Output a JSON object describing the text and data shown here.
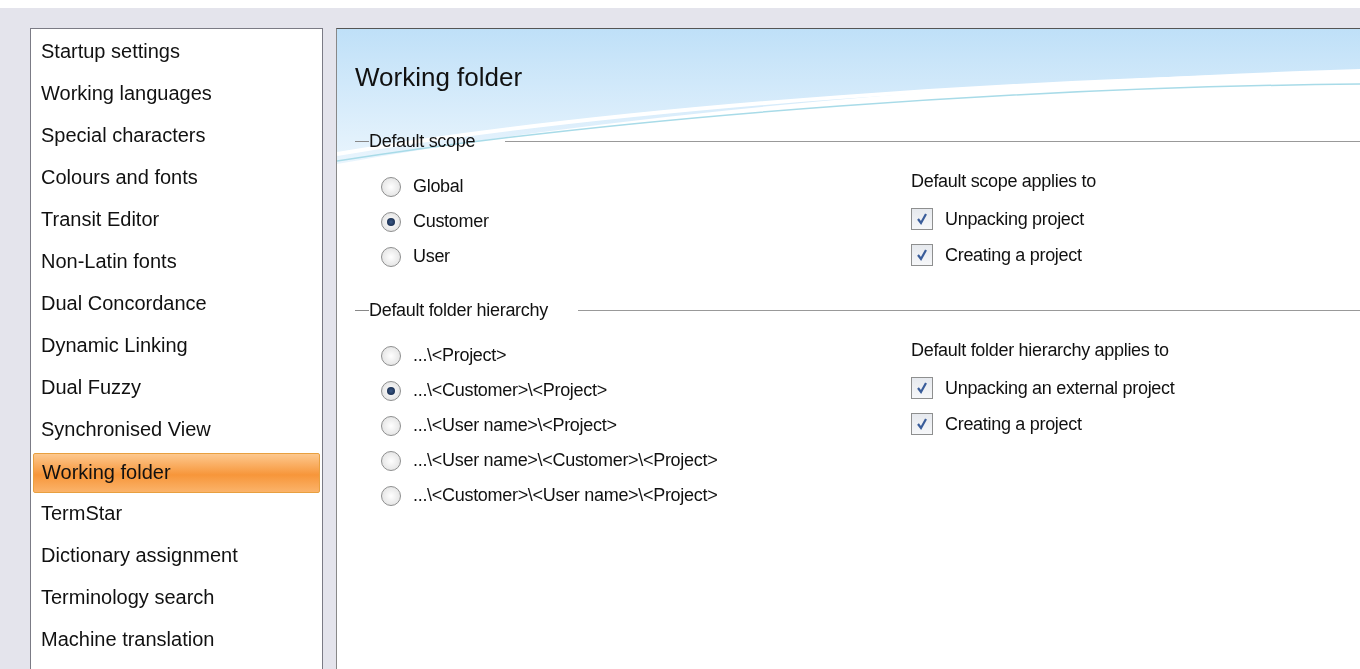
{
  "sidebar": {
    "items": [
      {
        "label": "Startup settings",
        "selected": false
      },
      {
        "label": "Working languages",
        "selected": false
      },
      {
        "label": "Special characters",
        "selected": false
      },
      {
        "label": "Colours and fonts",
        "selected": false
      },
      {
        "label": "Transit Editor",
        "selected": false
      },
      {
        "label": "Non-Latin fonts",
        "selected": false
      },
      {
        "label": "Dual Concordance",
        "selected": false
      },
      {
        "label": "Dynamic Linking",
        "selected": false
      },
      {
        "label": "Dual Fuzzy",
        "selected": false
      },
      {
        "label": "Synchronised View",
        "selected": false
      },
      {
        "label": "Working folder",
        "selected": true
      },
      {
        "label": "TermStar",
        "selected": false
      },
      {
        "label": "Dictionary assignment",
        "selected": false
      },
      {
        "label": "Terminology search",
        "selected": false
      },
      {
        "label": "Machine translation",
        "selected": false
      }
    ]
  },
  "panel": {
    "title": "Working folder",
    "groups": [
      {
        "title": "Default scope",
        "options": [
          {
            "label": "Global",
            "selected": false
          },
          {
            "label": "Customer",
            "selected": true
          },
          {
            "label": "User",
            "selected": false
          }
        ],
        "applies_label": "Default scope applies to",
        "checkboxes": [
          {
            "label": "Unpacking project",
            "checked": true
          },
          {
            "label": "Creating a project",
            "checked": true
          }
        ]
      },
      {
        "title": "Default folder hierarchy",
        "options": [
          {
            "label": "...\\<Project>",
            "selected": false
          },
          {
            "label": "...\\<Customer>\\<Project>",
            "selected": true
          },
          {
            "label": "...\\<User name>\\<Project>",
            "selected": false
          },
          {
            "label": "...\\<User name>\\<Customer>\\<Project>",
            "selected": false
          },
          {
            "label": "...\\<Customer>\\<User name>\\<Project>",
            "selected": false
          }
        ],
        "applies_label": "Default folder hierarchy applies to",
        "checkboxes": [
          {
            "label": "Unpacking an external project",
            "checked": true
          },
          {
            "label": "Creating a project",
            "checked": true
          }
        ]
      }
    ]
  }
}
